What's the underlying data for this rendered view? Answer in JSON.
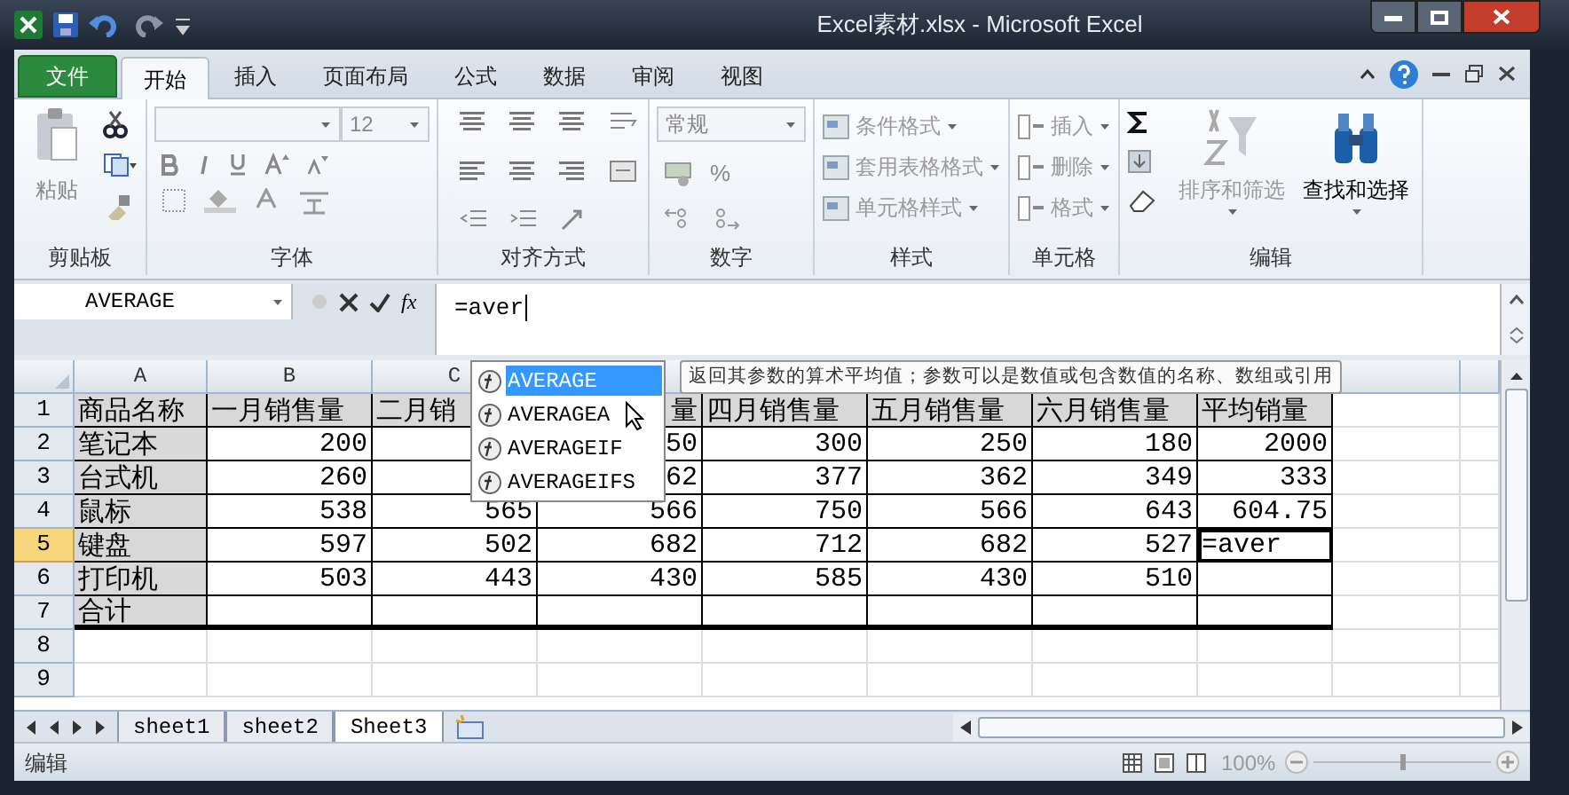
{
  "title_bar": {
    "title": "Excel素材.xlsx - Microsoft Excel"
  },
  "ribbon_tabs": [
    {
      "label": "文件",
      "kind": "file",
      "selected": false
    },
    {
      "label": "开始",
      "kind": "tab",
      "selected": true
    },
    {
      "label": "插入",
      "kind": "tab",
      "selected": false
    },
    {
      "label": "页面布局",
      "kind": "tab",
      "selected": false
    },
    {
      "label": "公式",
      "kind": "tab",
      "selected": false
    },
    {
      "label": "数据",
      "kind": "tab",
      "selected": false
    },
    {
      "label": "审阅",
      "kind": "tab",
      "selected": false
    },
    {
      "label": "视图",
      "kind": "tab",
      "selected": false
    }
  ],
  "ribbon": {
    "clipboard": {
      "label": "剪贴板",
      "paste": "粘贴"
    },
    "font": {
      "label": "字体",
      "size": "12"
    },
    "alignment": {
      "label": "对齐方式"
    },
    "number": {
      "label": "数字",
      "format": "常规",
      "percent": "%"
    },
    "styles": {
      "label": "样式",
      "items": [
        {
          "label": "条件格式",
          "disabled": true
        },
        {
          "label": "套用表格格式",
          "disabled": true
        },
        {
          "label": "单元格样式",
          "disabled": true
        }
      ]
    },
    "cells": {
      "label": "单元格",
      "items": [
        {
          "label": "插入",
          "disabled": true
        },
        {
          "label": "删除",
          "disabled": true
        },
        {
          "label": "格式",
          "disabled": true
        }
      ]
    },
    "editing": {
      "label": "编辑",
      "buttons": [
        {
          "label": "排序和筛选",
          "disabled": true
        },
        {
          "label": "查找和选择",
          "disabled": false
        }
      ]
    }
  },
  "formula_bar": {
    "name_box": "AVERAGE",
    "function_button": "fx",
    "formula": "=aver"
  },
  "sheet": {
    "columns": [
      "A",
      "B",
      "C"
    ],
    "rows": [
      {
        "header": "1",
        "selected": false,
        "cells": [
          "商品名称",
          "一月销售量",
          "二月销",
          "量",
          "四月销售量",
          "五月销售量",
          "六月销售量",
          "平均销量"
        ]
      },
      {
        "header": "2",
        "selected": false,
        "cells": [
          "笔记本",
          "200",
          null,
          "50",
          "300",
          "250",
          "180",
          "2000"
        ]
      },
      {
        "header": "3",
        "selected": false,
        "cells": [
          "台式机",
          "260",
          null,
          "62",
          "377",
          "362",
          "349",
          "333"
        ]
      },
      {
        "header": "4",
        "selected": false,
        "cells": [
          "鼠标",
          "538",
          "565",
          "566",
          "750",
          "566",
          "643",
          "604.75"
        ]
      },
      {
        "header": "5",
        "selected": true,
        "cells": [
          "键盘",
          "597",
          "502",
          "682",
          "712",
          "682",
          "527",
          "=aver"
        ]
      },
      {
        "header": "6",
        "selected": false,
        "cells": [
          "打印机",
          "503",
          "443",
          "430",
          "585",
          "430",
          "510",
          null
        ]
      },
      {
        "header": "7",
        "selected": false,
        "cells": [
          "合计",
          null,
          null,
          null,
          null,
          null,
          null,
          null
        ]
      },
      {
        "header": "8",
        "selected": false,
        "cells": []
      },
      {
        "header": "9",
        "selected": false,
        "cells": []
      }
    ]
  },
  "autocomplete": {
    "items": [
      {
        "label": "AVERAGE",
        "selected": true
      },
      {
        "label": "AVERAGEA",
        "selected": false
      },
      {
        "label": "AVERAGEIF",
        "selected": false
      },
      {
        "label": "AVERAGEIFS",
        "selected": false
      }
    ],
    "tooltip": "返回其参数的算术平均值；参数可以是数值或包含数值的名称、数组或引用"
  },
  "sheet_tabs": [
    {
      "label": "sheet1",
      "selected": false
    },
    {
      "label": "sheet2",
      "selected": false
    },
    {
      "label": "Sheet3",
      "selected": true
    }
  ],
  "status_bar": {
    "mode": "编辑",
    "zoom": "100%",
    "zoom_slider": {
      "level": 0.5
    }
  }
}
